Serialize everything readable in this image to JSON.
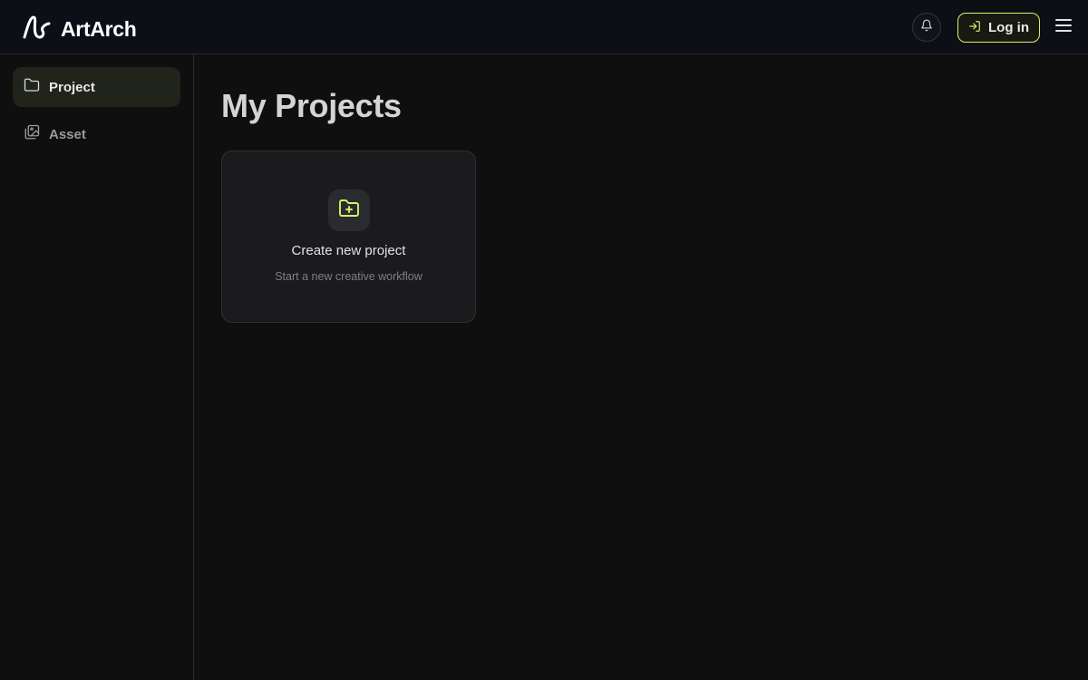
{
  "header": {
    "brand_name": "ArtArch",
    "login_label": "Log in",
    "icons": {
      "logo": "artarch-logo-icon",
      "bell": "bell-icon",
      "login": "login-arrow-icon",
      "menu": "hamburger-menu-icon"
    },
    "colors": {
      "accent": "#d8ef6a",
      "background": "#0d0f17"
    }
  },
  "sidebar": {
    "items": [
      {
        "label": "Project",
        "icon": "folder-icon",
        "active": true
      },
      {
        "label": "Asset",
        "icon": "images-icon",
        "active": false
      }
    ]
  },
  "main": {
    "title": "My Projects",
    "create_card": {
      "title": "Create new project",
      "subtitle": "Start a new creative workflow",
      "icon": "folder-plus-icon"
    }
  }
}
